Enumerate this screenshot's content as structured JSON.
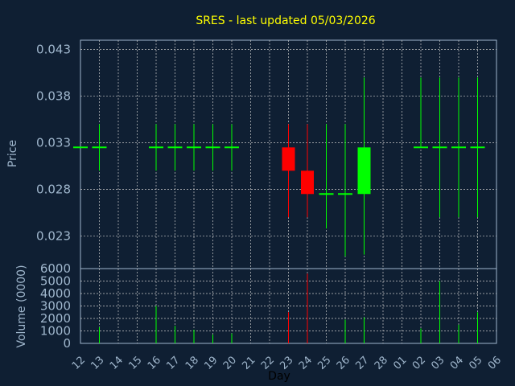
{
  "chart_data": {
    "type": "candlestick",
    "title": "SRES - last updated 05/03/2026",
    "xlabel": "Day",
    "price_panel": {
      "ylabel": "Price",
      "yticks": [
        "0.043",
        "0.038",
        "0.033",
        "0.028",
        "0.023"
      ],
      "ylim": [
        0.0195,
        0.044
      ]
    },
    "volume_panel": {
      "ylabel": "Volume (0000)",
      "yticks": [
        "6000",
        "5000",
        "4000",
        "3000",
        "2000",
        "1000",
        "0"
      ],
      "ylim": [
        0,
        6000
      ]
    },
    "x_tick_labels": [
      "12",
      "13",
      "14",
      "15",
      "16",
      "17",
      "18",
      "19",
      "20",
      "21",
      "22",
      "23",
      "24",
      "25",
      "26",
      "27",
      "28",
      "01",
      "02",
      "03",
      "04",
      "05",
      "06"
    ],
    "colors": {
      "up": "#00ff00",
      "down": "#ff0000",
      "flat": "#00ff00",
      "title": "#ffff00",
      "grid": "#c8c8c8",
      "background": "#0f1f33",
      "frame": "#9fb6cc"
    },
    "candles": [
      {
        "x": "12",
        "open": 0.0325,
        "high": 0.0325,
        "low": 0.0325,
        "close": 0.0325,
        "volume": 0
      },
      {
        "x": "13",
        "open": 0.0325,
        "high": 0.035,
        "low": 0.03,
        "close": 0.0325,
        "volume": 1300
      },
      {
        "x": "16",
        "open": 0.0325,
        "high": 0.035,
        "low": 0.03,
        "close": 0.0325,
        "volume": 3000
      },
      {
        "x": "17",
        "open": 0.0325,
        "high": 0.035,
        "low": 0.03,
        "close": 0.0325,
        "volume": 1400
      },
      {
        "x": "18",
        "open": 0.0325,
        "high": 0.035,
        "low": 0.03,
        "close": 0.0325,
        "volume": 1100
      },
      {
        "x": "19",
        "open": 0.0325,
        "high": 0.035,
        "low": 0.03,
        "close": 0.0325,
        "volume": 700
      },
      {
        "x": "20",
        "open": 0.0325,
        "high": 0.035,
        "low": 0.03,
        "close": 0.0325,
        "volume": 800
      },
      {
        "x": "23",
        "open": 0.0325,
        "high": 0.035,
        "low": 0.025,
        "close": 0.03,
        "volume": 2500
      },
      {
        "x": "24",
        "open": 0.03,
        "high": 0.035,
        "low": 0.025,
        "close": 0.0275,
        "volume": 5600
      },
      {
        "x": "25",
        "open": 0.0275,
        "high": 0.035,
        "low": 0.0238,
        "close": 0.0275,
        "volume": 0
      },
      {
        "x": "26",
        "open": 0.0275,
        "high": 0.035,
        "low": 0.0208,
        "close": 0.0275,
        "volume": 1900
      },
      {
        "x": "27",
        "open": 0.0275,
        "high": 0.04,
        "low": 0.021,
        "close": 0.0325,
        "volume": 2100
      },
      {
        "x": "02",
        "open": 0.0325,
        "high": 0.04,
        "low": 0.0325,
        "close": 0.0325,
        "volume": 1200
      },
      {
        "x": "03",
        "open": 0.0325,
        "high": 0.04,
        "low": 0.025,
        "close": 0.0325,
        "volume": 5000
      },
      {
        "x": "04",
        "open": 0.0325,
        "high": 0.04,
        "low": 0.025,
        "close": 0.0325,
        "volume": 1500
      },
      {
        "x": "05",
        "open": 0.0325,
        "high": 0.04,
        "low": 0.025,
        "close": 0.0325,
        "volume": 2500
      }
    ]
  }
}
